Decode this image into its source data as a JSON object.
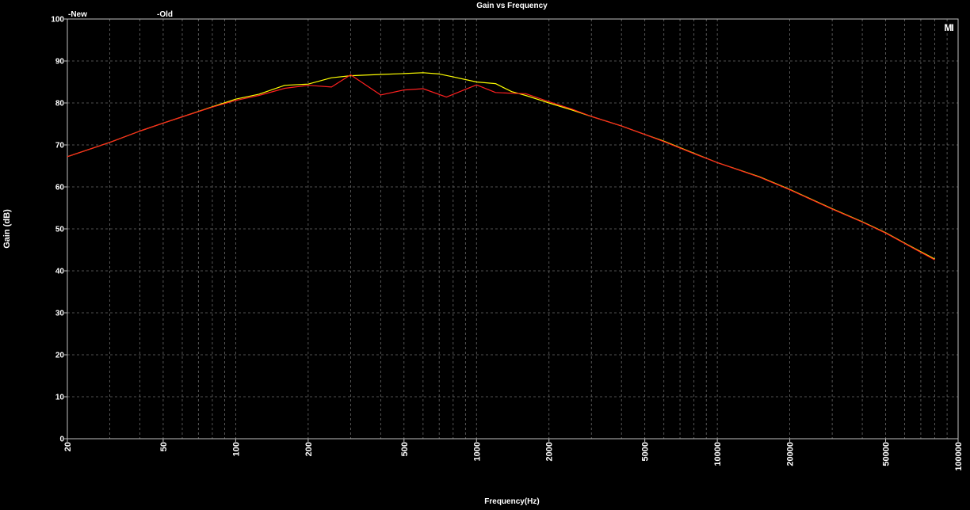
{
  "chart_data": {
    "type": "line",
    "title": "Gain vs Frequency",
    "xlabel": "Frequency(Hz)",
    "ylabel": "Gain (dB)",
    "x_scale": "log",
    "xlim": [
      20,
      100000
    ],
    "ylim": [
      0,
      100
    ],
    "grid": true,
    "legend_position": "top-left",
    "x_ticks": [
      "20",
      "50",
      "100",
      "200",
      "500",
      "1000",
      "2000",
      "5000",
      "10000",
      "20000",
      "50000",
      "100000"
    ],
    "y_ticks": [
      "0",
      "10",
      "20",
      "30",
      "40",
      "50",
      "60",
      "70",
      "80",
      "90",
      "100"
    ],
    "series": [
      {
        "name": "New",
        "legend_label": "-New",
        "color": "#ffff00",
        "points": [
          [
            20,
            67.2
          ],
          [
            30,
            70.6
          ],
          [
            40,
            73.3
          ],
          [
            50,
            75.2
          ],
          [
            60,
            76.7
          ],
          [
            80,
            79.1
          ],
          [
            100,
            80.9
          ],
          [
            125,
            82.1
          ],
          [
            160,
            84.2
          ],
          [
            200,
            84.5
          ],
          [
            250,
            86.0
          ],
          [
            300,
            86.5
          ],
          [
            400,
            86.8
          ],
          [
            500,
            87.0
          ],
          [
            600,
            87.2
          ],
          [
            700,
            86.9
          ],
          [
            800,
            86.2
          ],
          [
            1000,
            85.0
          ],
          [
            1200,
            84.6
          ],
          [
            1400,
            82.7
          ],
          [
            1600,
            81.8
          ],
          [
            2000,
            80.0
          ],
          [
            2500,
            78.3
          ],
          [
            3000,
            76.8
          ],
          [
            4000,
            74.5
          ],
          [
            5000,
            72.5
          ],
          [
            6000,
            70.9
          ],
          [
            8000,
            68.0
          ],
          [
            10000,
            65.8
          ],
          [
            15000,
            62.4
          ],
          [
            20000,
            59.4
          ],
          [
            30000,
            54.8
          ],
          [
            40000,
            51.7
          ],
          [
            50000,
            49.1
          ],
          [
            60000,
            46.6
          ],
          [
            80000,
            42.8
          ]
        ]
      },
      {
        "name": "Old",
        "legend_label": "-Old",
        "color": "#ff2020",
        "points": [
          [
            20,
            67.2
          ],
          [
            30,
            70.6
          ],
          [
            40,
            73.3
          ],
          [
            50,
            75.2
          ],
          [
            60,
            76.7
          ],
          [
            80,
            79.0
          ],
          [
            100,
            80.6
          ],
          [
            125,
            81.8
          ],
          [
            160,
            83.5
          ],
          [
            200,
            84.2
          ],
          [
            250,
            83.8
          ],
          [
            300,
            86.7
          ],
          [
            400,
            81.9
          ],
          [
            500,
            83.1
          ],
          [
            600,
            83.4
          ],
          [
            750,
            81.4
          ],
          [
            1000,
            84.3
          ],
          [
            1200,
            82.5
          ],
          [
            1400,
            82.3
          ],
          [
            1600,
            82.2
          ],
          [
            2000,
            80.3
          ],
          [
            2500,
            78.5
          ],
          [
            3000,
            76.8
          ],
          [
            4000,
            74.5
          ],
          [
            5000,
            72.5
          ],
          [
            6000,
            70.8
          ],
          [
            8000,
            67.9
          ],
          [
            10000,
            65.8
          ],
          [
            15000,
            62.3
          ],
          [
            20000,
            59.3
          ],
          [
            30000,
            54.7
          ],
          [
            40000,
            51.6
          ],
          [
            50000,
            49.0
          ],
          [
            60000,
            46.5
          ],
          [
            80000,
            42.6
          ]
        ]
      }
    ]
  },
  "logo": {
    "text": "MI"
  }
}
